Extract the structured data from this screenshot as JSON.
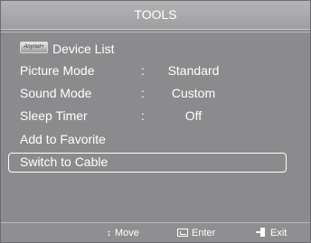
{
  "title": "TOOLS",
  "menu": {
    "items": [
      {
        "label": "Device List",
        "prefix_icon": "anynet-logo",
        "logo_text": "Anynet+"
      },
      {
        "label": "Picture Mode",
        "separator": ":",
        "value": "Standard"
      },
      {
        "label": "Sound Mode",
        "separator": ":",
        "value": "Custom"
      },
      {
        "label": "Sleep Timer",
        "separator": ":",
        "value": "Off"
      },
      {
        "label": "Add to Favorite"
      },
      {
        "label": "Switch to Cable",
        "selected": true
      }
    ]
  },
  "footer": {
    "move": {
      "icon": "up-down-arrows-icon",
      "label": "Move"
    },
    "enter": {
      "icon": "enter-icon",
      "label": "Enter"
    },
    "exit": {
      "icon": "exit-icon",
      "label": "Exit"
    }
  },
  "colors": {
    "panel": "#8b8b8d",
    "titlebar": "#a8a8aa",
    "text": "#ffffff",
    "highlight_border": "#ffffff"
  }
}
